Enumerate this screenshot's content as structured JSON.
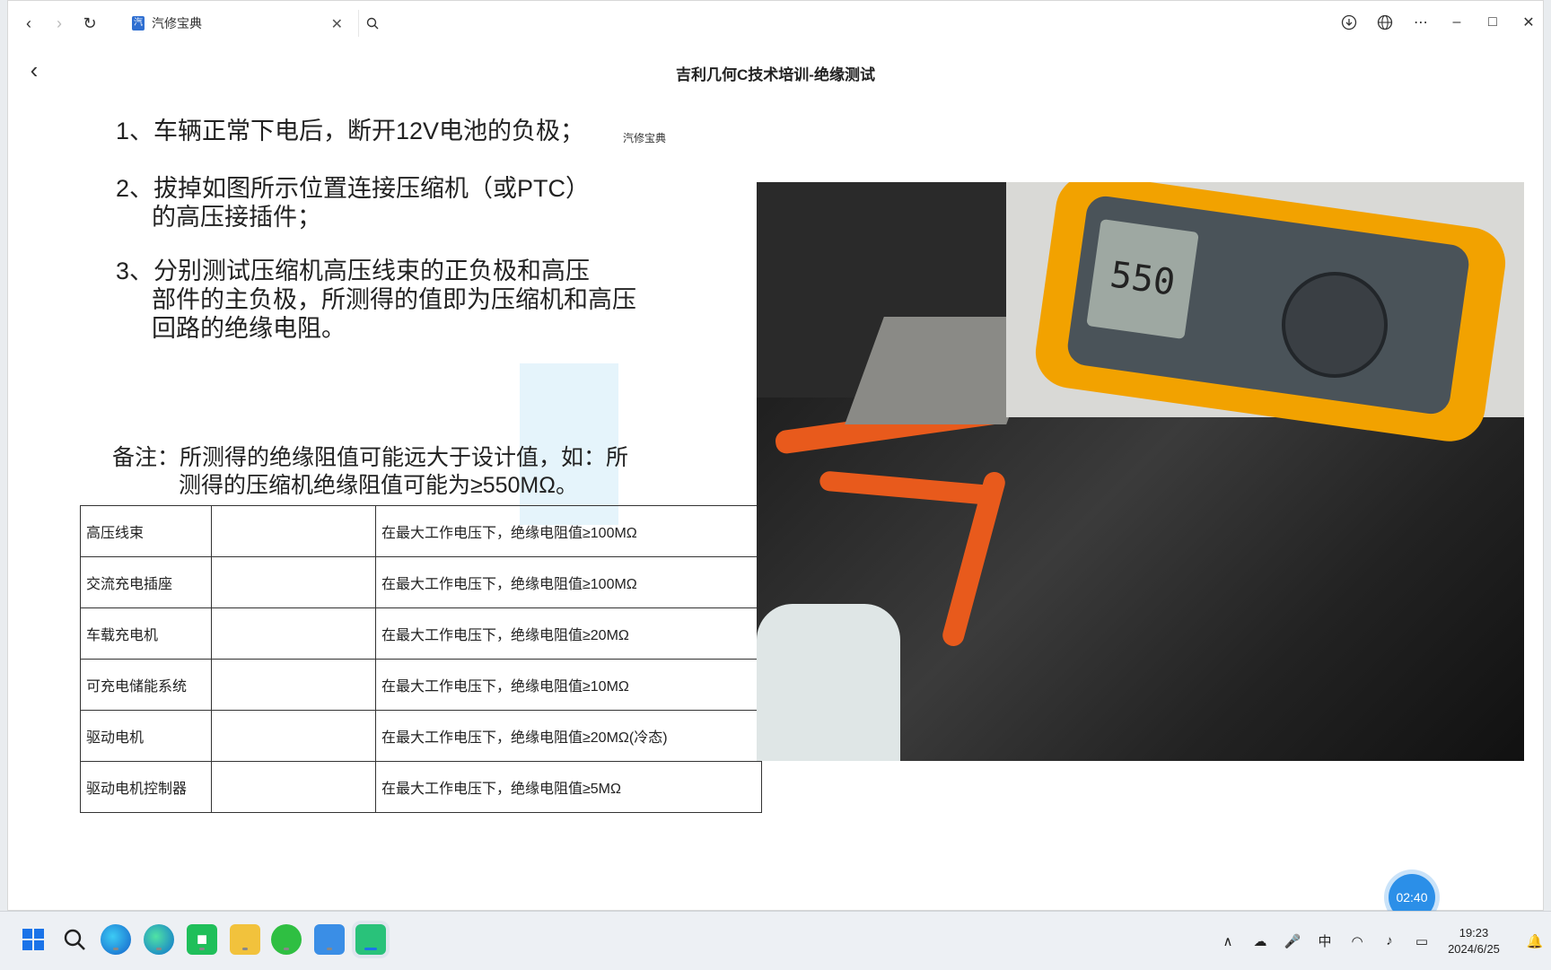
{
  "browser": {
    "tab_title": "汽修宝典",
    "favicon_glyph": "汽"
  },
  "page": {
    "title": "吉利几何C技术培训-绝缘测试"
  },
  "slide": {
    "watermark": "汽修宝典",
    "steps": [
      "1、车辆正常下电后，断开12V电池的负极；",
      "2、拔掉如图所示位置连接压缩机（或PTC）",
      "的高压接插件；",
      "3、分别测试压缩机高压线束的正负极和高压",
      "部件的主负极，所测得的值即为压缩机和高压",
      "回路的绝缘电阻。"
    ],
    "note_line1": "备注：所测得的绝缘阻值可能远大于设计值，如：所",
    "note_line2": "测得的压缩机绝缘阻值可能为≥550MΩ。",
    "meter_reading": "550",
    "table": [
      {
        "part": "高压线束",
        "value": "",
        "requirement": "在最大工作电压下，绝缘电阻值≥100MΩ"
      },
      {
        "part": "交流充电插座",
        "value": "",
        "requirement": "在最大工作电压下，绝缘电阻值≥100MΩ"
      },
      {
        "part": "车载充电机",
        "value": "",
        "requirement": "在最大工作电压下，绝缘电阻值≥20MΩ"
      },
      {
        "part": "可充电储能系统",
        "value": "",
        "requirement": "在最大工作电压下，绝缘电阻值≥10MΩ"
      },
      {
        "part": "驱动电机",
        "value": "",
        "requirement": "在最大工作电压下，绝缘电阻值≥20MΩ(冷态)"
      },
      {
        "part": "驱动电机控制器",
        "value": "",
        "requirement": "在最大工作电压下，绝缘电阻值≥5MΩ"
      }
    ]
  },
  "player": {
    "timer": "02:40"
  },
  "taskbar": {
    "time": "19:23",
    "date": "2024/6/25",
    "ime": "中",
    "apps": [
      "windows-start",
      "search",
      "edge-dev",
      "edge",
      "wechat-work",
      "file-explorer",
      "wechat",
      "remote-desktop",
      "active-window"
    ]
  }
}
